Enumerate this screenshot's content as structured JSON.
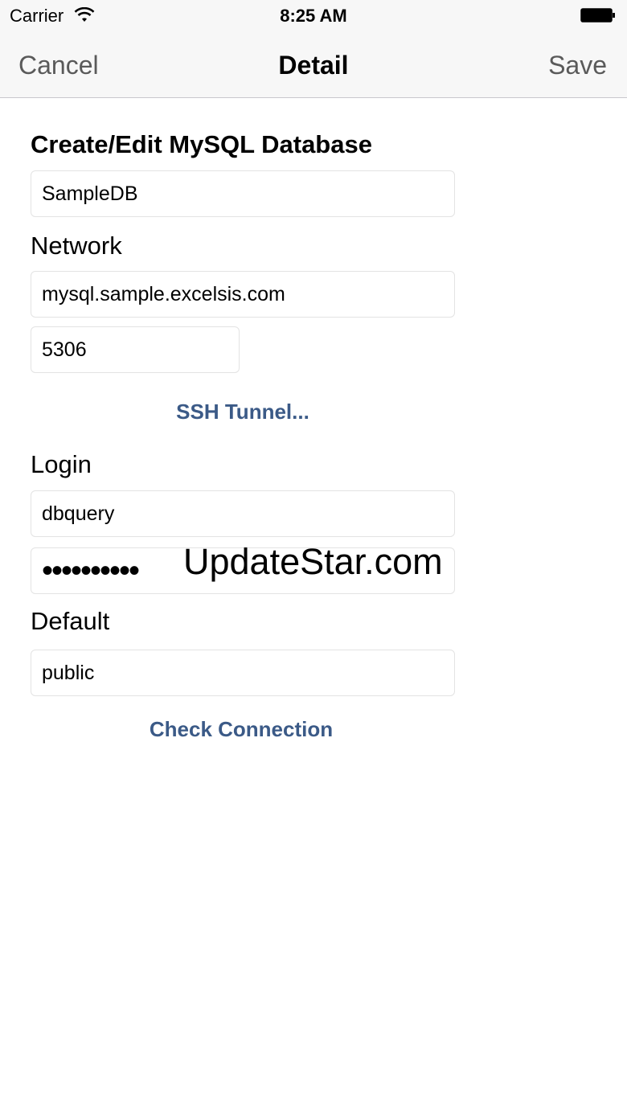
{
  "status_bar": {
    "carrier": "Carrier",
    "time": "8:25 AM"
  },
  "nav": {
    "cancel_label": "Cancel",
    "title": "Detail",
    "save_label": "Save"
  },
  "form": {
    "heading": "Create/Edit MySQL Database",
    "database_name": "SampleDB",
    "network_label": "Network",
    "host": "mysql.sample.excelsis.com",
    "port": "5306",
    "ssh_tunnel_label": "SSH Tunnel...",
    "login_label": "Login",
    "username": "dbquery",
    "password_masked": "••••••••••",
    "default_label": "Default",
    "default_schema": "public",
    "check_connection_label": "Check Connection"
  },
  "watermark": "UpdateStar.com",
  "colors": {
    "link": "#3b5a87",
    "bar_background": "#f7f7f7"
  }
}
